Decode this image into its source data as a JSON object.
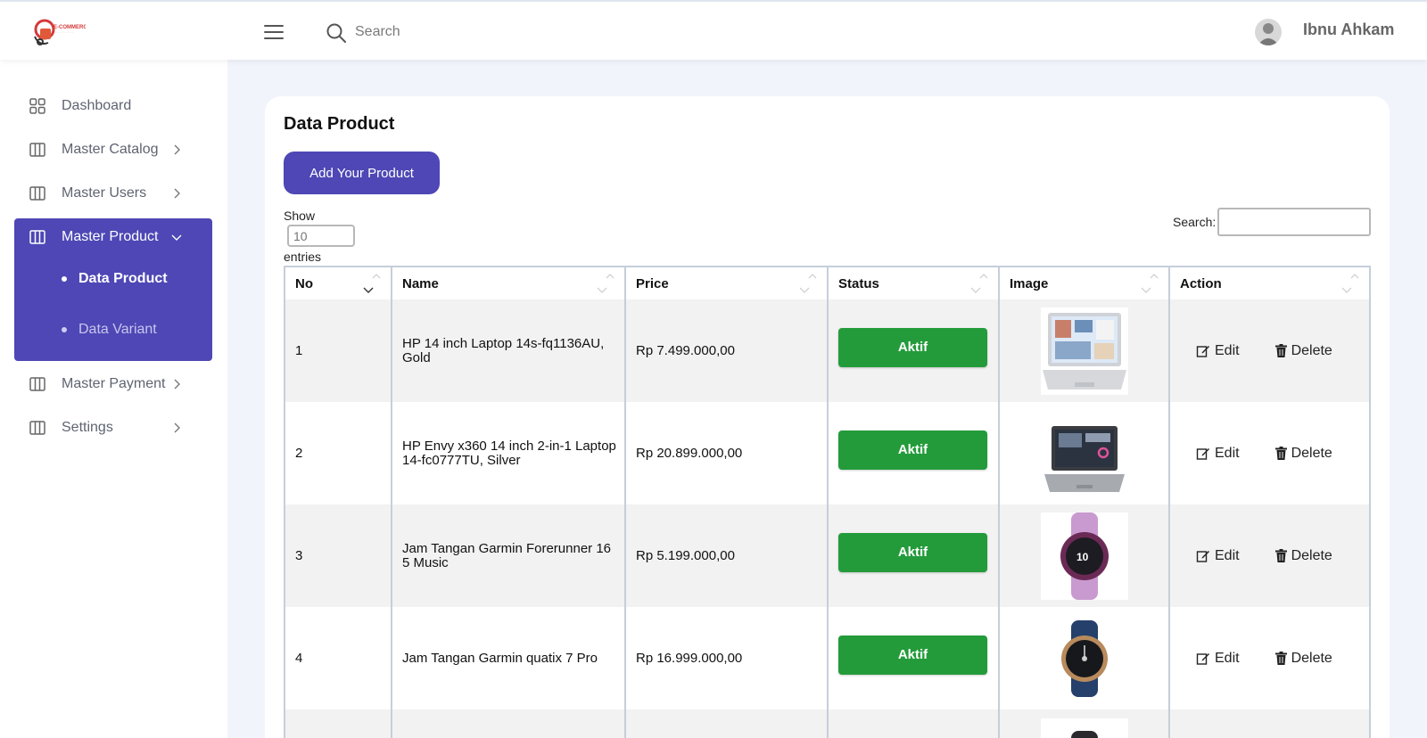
{
  "header": {
    "logo_name": "E-COMMERCE",
    "search_placeholder": "Search",
    "user_name": "Ibnu Ahkam"
  },
  "sidebar": {
    "items": [
      {
        "label": "Dashboard",
        "icon": "grid-icon"
      },
      {
        "label": "Master Catalog",
        "icon": "columns-icon"
      },
      {
        "label": "Master Users",
        "icon": "columns-icon"
      },
      {
        "label": "Master Product",
        "icon": "columns-icon",
        "expanded": true
      },
      {
        "label": "Master Payment",
        "icon": "columns-icon"
      },
      {
        "label": "Settings",
        "icon": "columns-icon"
      }
    ],
    "sub_items": [
      {
        "label": "Data Product",
        "active": true
      },
      {
        "label": "Data Variant",
        "active": false
      }
    ],
    "active_color": "#4e47b5"
  },
  "page": {
    "title": "Data Product",
    "add_button": "Add Your Product",
    "show_label": "Show",
    "length_placeholder": "10",
    "entries_label": "entries",
    "search_label": "Search:"
  },
  "table": {
    "columns": [
      "No",
      "Name",
      "Price",
      "Status",
      "Image",
      "Action"
    ],
    "rows": [
      {
        "no": "1",
        "name": "HP 14 inch Laptop 14s-fq1136AU, Gold",
        "price": "Rp 7.499.000,00",
        "status": "Aktif",
        "image": "laptop-image",
        "edit": "Edit",
        "delete": "Delete"
      },
      {
        "no": "2",
        "name": "HP Envy x360 14 inch 2-in-1 Laptop 14-fc0777TU, Silver",
        "price": "Rp 20.899.000,00",
        "status": "Aktif",
        "image": "laptop-dark-image",
        "edit": "Edit",
        "delete": "Delete"
      },
      {
        "no": "3",
        "name": "Jam Tangan Garmin Forerunner 165 Music",
        "price": "Rp 5.199.000,00",
        "status": "Aktif",
        "image": "smartwatch-pink-image",
        "edit": "Edit",
        "delete": "Delete"
      },
      {
        "no": "4",
        "name": "Jam Tangan Garmin quatix 7 Pro",
        "price": "Rp 16.999.000,00",
        "status": "Aktif",
        "image": "smartwatch-blue-image",
        "edit": "Edit",
        "delete": "Delete"
      }
    ],
    "status_color": "#239b3a"
  }
}
